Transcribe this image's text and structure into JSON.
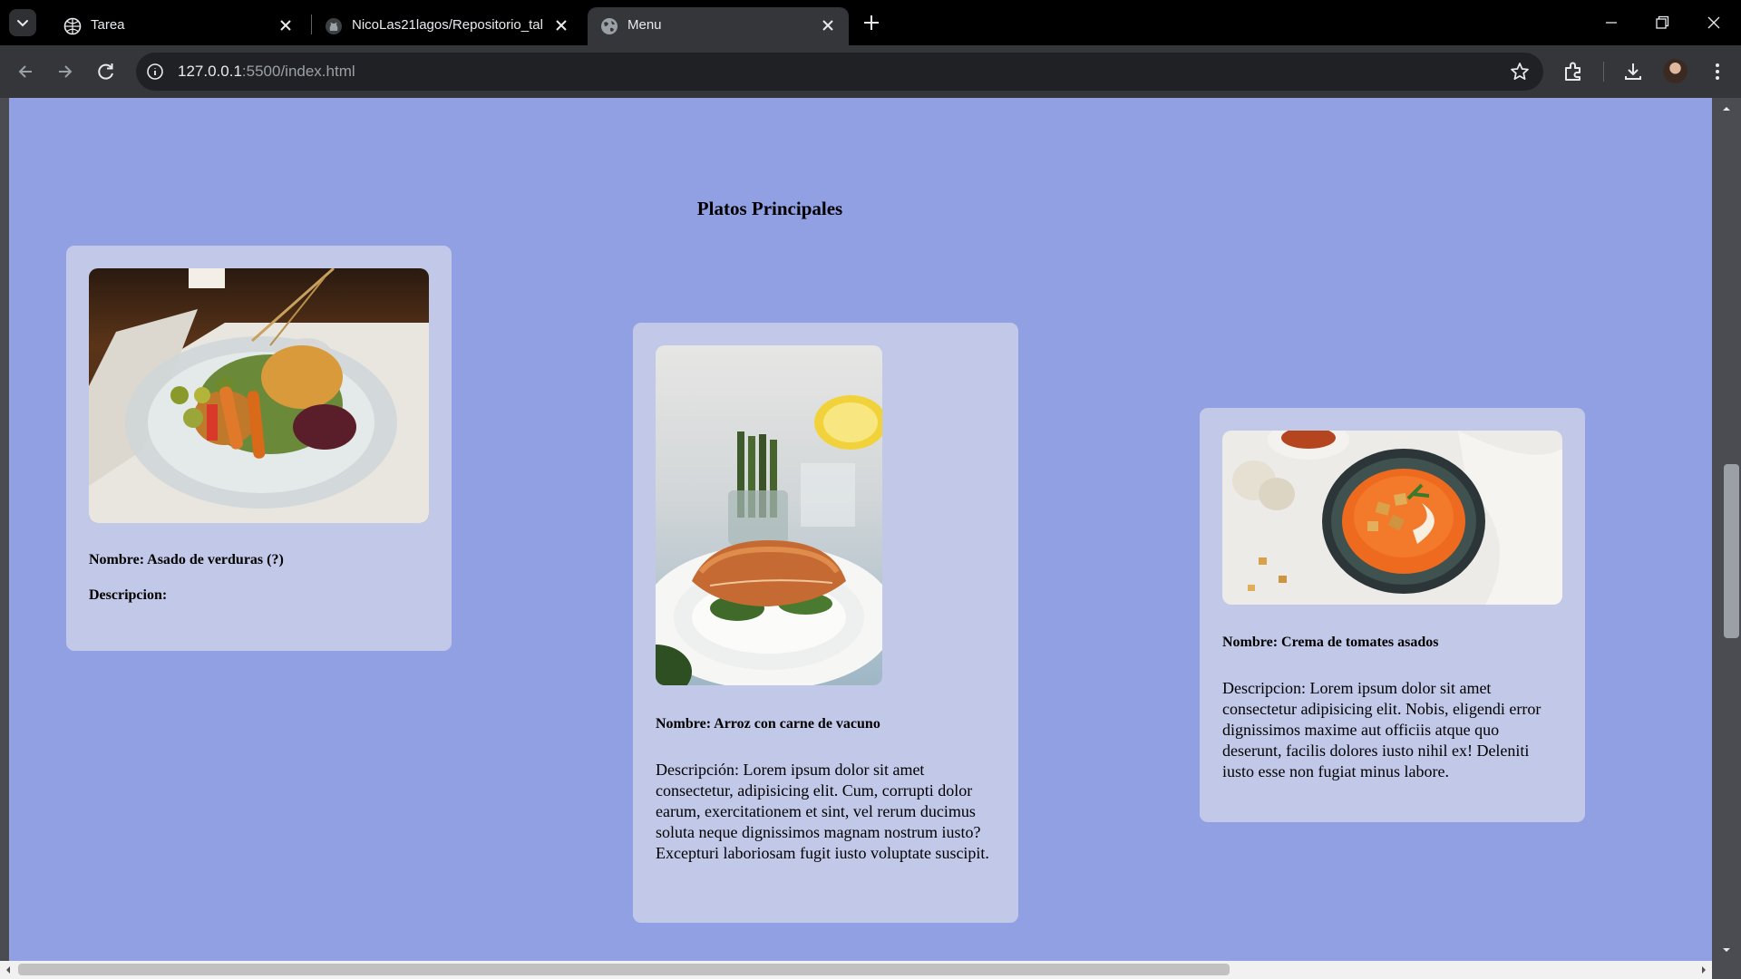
{
  "browser": {
    "tabs": [
      {
        "title": "Tarea",
        "icon": "globe-icon",
        "active": false
      },
      {
        "title": "NicoLas21lagos/Repositorio_tal",
        "icon": "github-icon",
        "active": false
      },
      {
        "title": "Menu",
        "icon": "world-icon",
        "active": true
      }
    ],
    "url": {
      "host": "127.0.0.1",
      "rest": ":5500/index.html"
    }
  },
  "page": {
    "section_title": "Platos Principales",
    "colors": {
      "background": "#919fe3",
      "card": "#c2c8e8"
    },
    "dishes": [
      {
        "image": "grilled-vegetables-plate",
        "name": "Nombre: Asado de verduras (?)",
        "description": "Descripcion:"
      },
      {
        "image": "salmon-rice-plate",
        "name": "Nombre: Arroz con carne de vacuno",
        "description": "Descripción: Lorem ipsum dolor sit amet consectetur, adipisicing elit. Cum, corrupti dolor earum, exercitationem et sint, vel rerum ducimus soluta neque dignissimos magnam nostrum iusto? Excepturi laboriosam fugit iusto voluptate suscipit."
      },
      {
        "image": "tomato-soup-bowl",
        "name": "Nombre: Crema de tomates asados",
        "description": "Descripcion: Lorem ipsum dolor sit amet consectetur adipisicing elit. Nobis, eligendi error dignissimos maxime aut officiis atque quo deserunt, facilis dolores iusto nihil ex! Deleniti iusto esse non fugiat minus labore."
      }
    ]
  }
}
